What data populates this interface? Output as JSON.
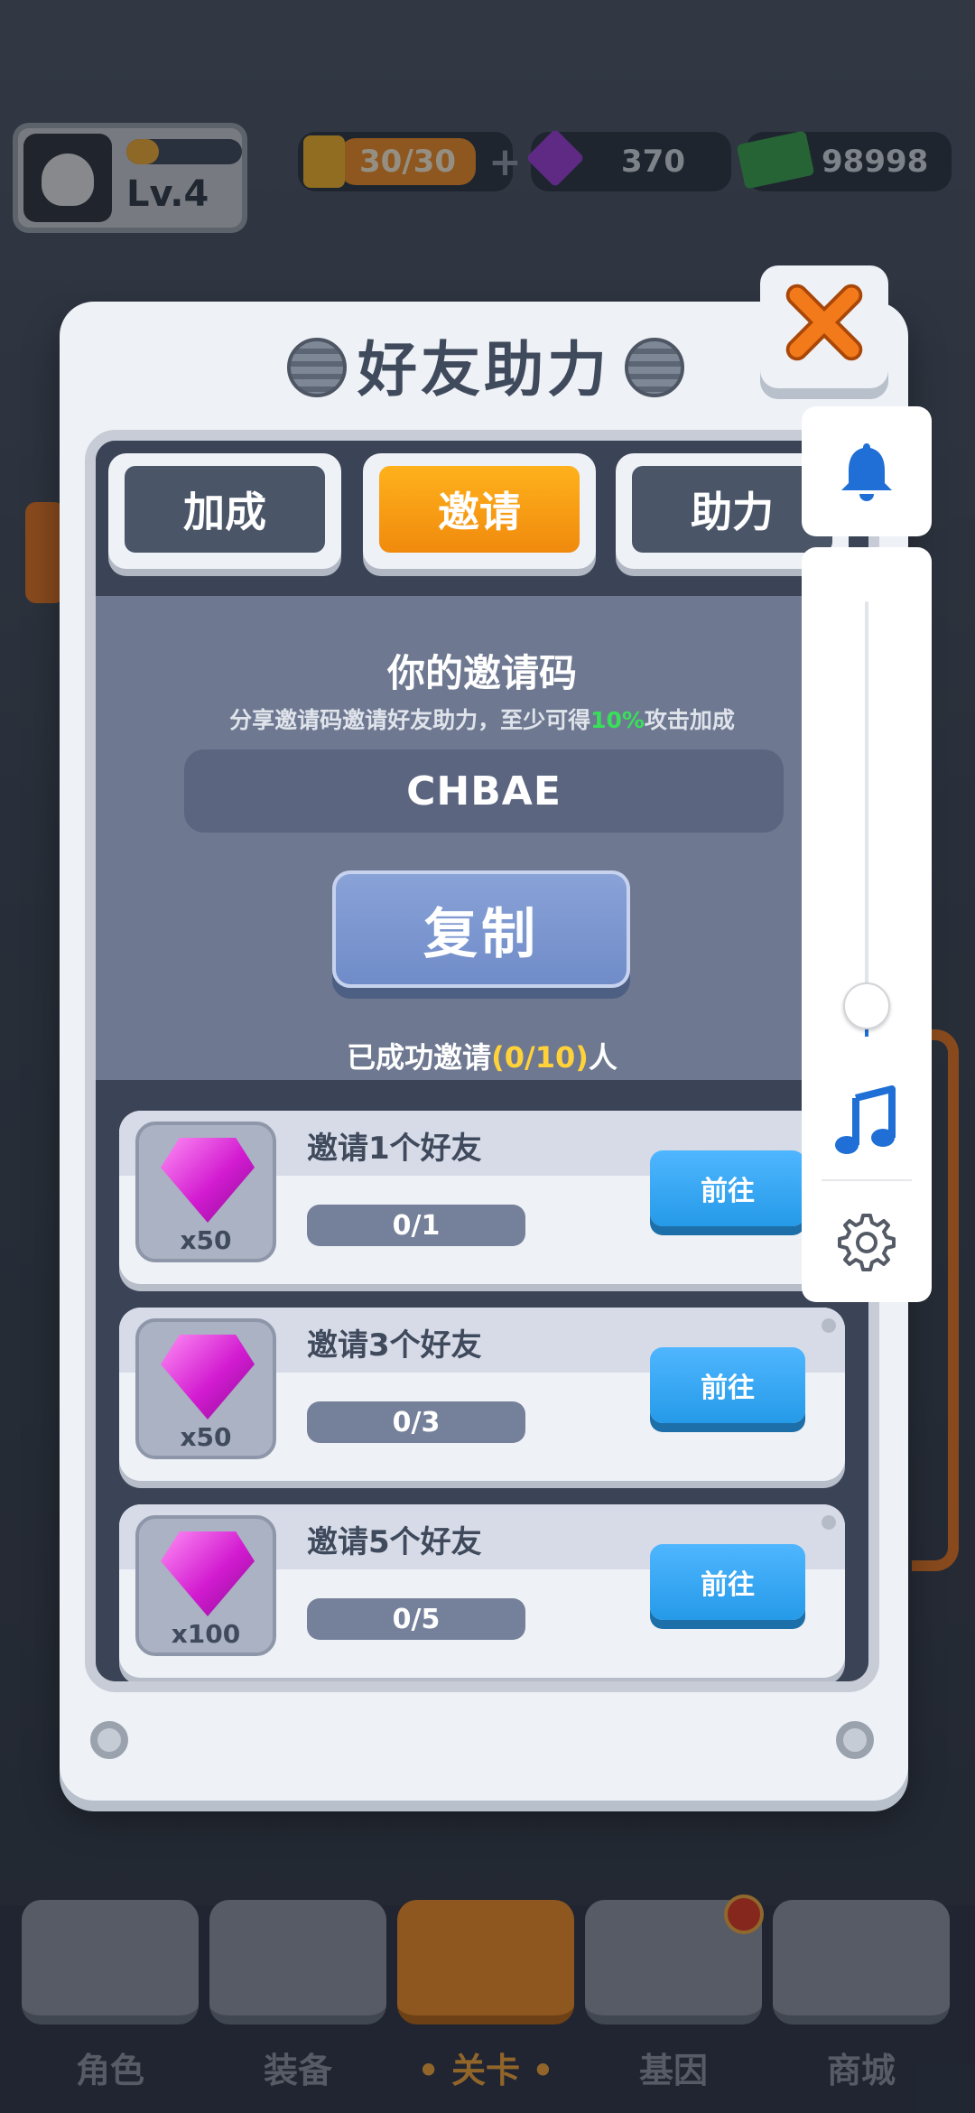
{
  "hud": {
    "level": "Lv.4",
    "exp_fraction": 0.28,
    "energy": "30/30",
    "energy_plus": "+",
    "gems": "370",
    "cash": "98998"
  },
  "panel": {
    "title": "好友助力",
    "close_icon": "close-x-icon",
    "tabs": [
      {
        "label": "加成",
        "active": false
      },
      {
        "label": "邀请",
        "active": true
      },
      {
        "label": "助力",
        "active": false
      }
    ],
    "invite": {
      "title": "你的邀请码",
      "subtitle_pre": "分享邀请码邀请好友助力，至少可得",
      "subtitle_pct": "10%",
      "subtitle_post": "攻击加成",
      "code": "CHBAE",
      "copy_label": "复制",
      "invited_pre": "已成功邀请",
      "invited_count": "(0/10)",
      "invited_post": "人"
    },
    "rewards": [
      {
        "title": "邀请1个好友",
        "qty": "x50",
        "progress": "0/1",
        "button": "前往",
        "icon": "gem-icon"
      },
      {
        "title": "邀请3个好友",
        "qty": "x50",
        "progress": "0/3",
        "button": "前往",
        "icon": "gem-icon"
      },
      {
        "title": "邀请5个好友",
        "qty": "x100",
        "progress": "0/5",
        "button": "前往",
        "icon": "gem-icon"
      }
    ]
  },
  "nav": {
    "items": [
      {
        "label": "角色",
        "active": false
      },
      {
        "label": "装备",
        "active": false
      },
      {
        "label": "• 关卡 •",
        "active": true
      },
      {
        "label": "基因",
        "active": false
      },
      {
        "label": "商城",
        "active": false
      }
    ]
  },
  "system_panel": {
    "volume_fraction": 0.03,
    "icons": [
      "bell-icon",
      "music-note-icon",
      "gear-icon"
    ],
    "accent": "#1f6fd6"
  },
  "colors": {
    "accent_orange": "#f08a1f",
    "button_blue": "#259ae8",
    "highlight_green": "#38e05a",
    "highlight_yellow": "#ffd23a"
  }
}
